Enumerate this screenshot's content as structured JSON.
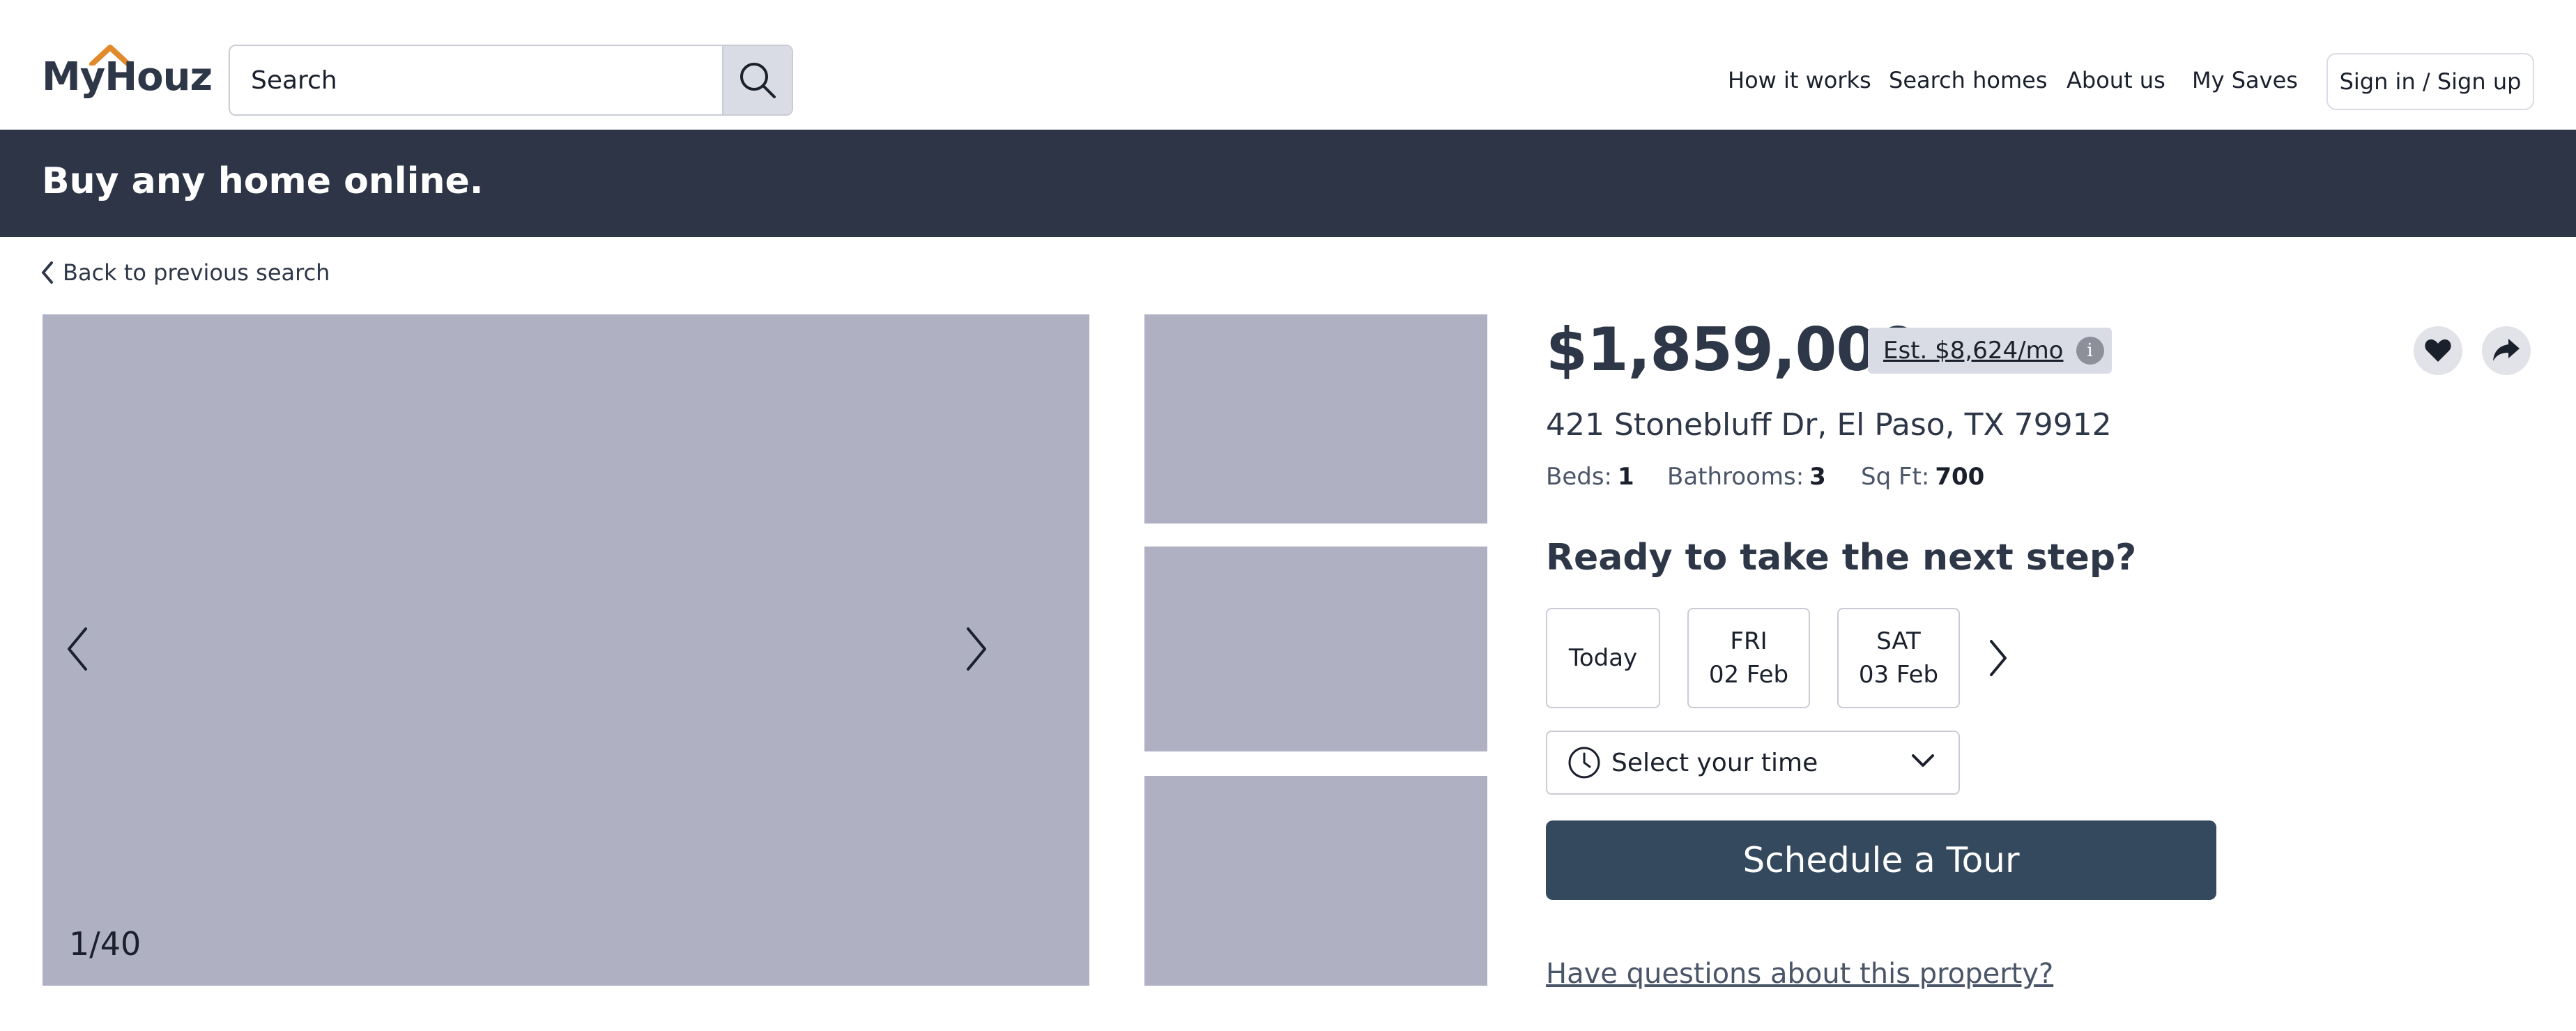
{
  "header": {
    "logo_text": "MyHouz",
    "search": {
      "placeholder": "Search"
    },
    "nav": [
      "How it works",
      "Search homes",
      "About us",
      "My Saves"
    ],
    "signin_label": "Sign in / Sign up"
  },
  "banner": {
    "title": "Buy any home online."
  },
  "back_link": "Back to previous search",
  "gallery": {
    "counter": "1/40"
  },
  "listing": {
    "price": "$1,859,000",
    "estimate": "Est. $8,624/mo",
    "address": "421 Stonebluff Dr, El Paso, TX 79912",
    "facts": [
      {
        "label": "Beds:",
        "value": "1"
      },
      {
        "label": "Bathrooms:",
        "value": "3"
      },
      {
        "label": "Sq Ft:",
        "value": "700"
      }
    ]
  },
  "tour": {
    "heading": "Ready to take the next step?",
    "days": [
      {
        "line1": "Today",
        "line2": ""
      },
      {
        "line1": "FRI",
        "line2": "02 Feb"
      },
      {
        "line1": "SAT",
        "line2": "03 Feb"
      }
    ],
    "time_placeholder": "Select your time",
    "schedule_label": "Schedule a Tour",
    "questions_link": "Have questions about this property?"
  },
  "colors": {
    "banner_bg": "#2e3546",
    "primary_button": "#34495e",
    "photo_placeholder": "#afb1c2",
    "logo_roof": "#e08a2c"
  }
}
